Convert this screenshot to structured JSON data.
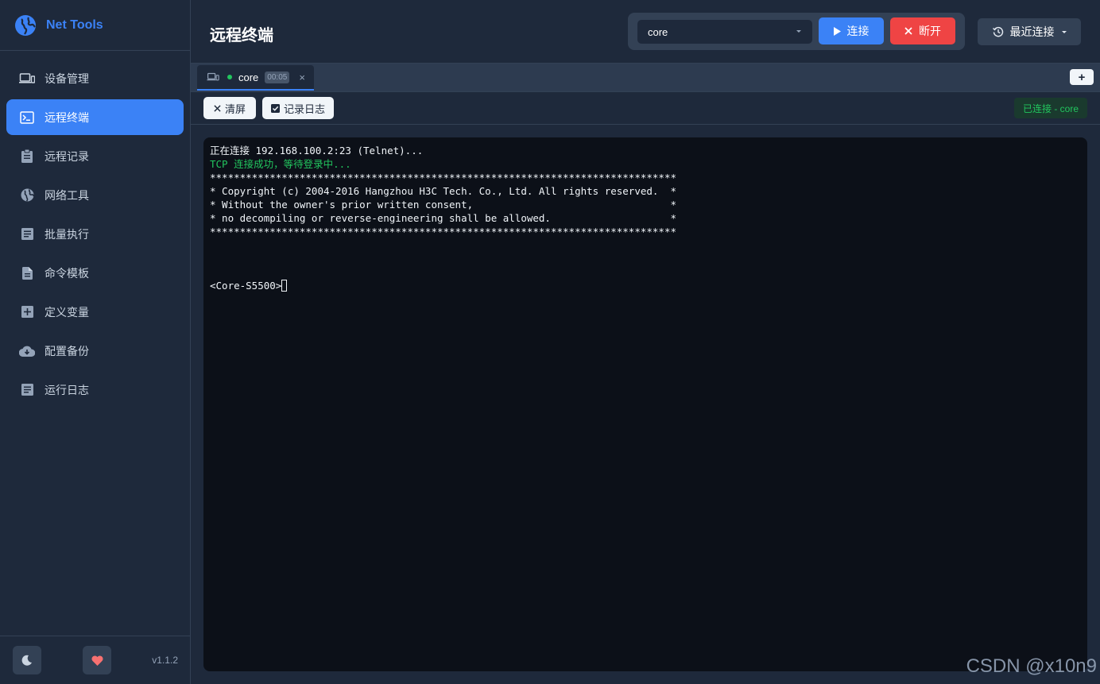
{
  "app": {
    "name": "Net Tools",
    "version": "v1.1.2"
  },
  "sidebar": {
    "items": [
      {
        "label": "设备管理",
        "icon": "devices-icon"
      },
      {
        "label": "远程终端",
        "icon": "terminal-icon",
        "active": true
      },
      {
        "label": "远程记录",
        "icon": "clipboard-icon"
      },
      {
        "label": "网络工具",
        "icon": "globe-icon"
      },
      {
        "label": "批量执行",
        "icon": "list-icon"
      },
      {
        "label": "命令模板",
        "icon": "file-icon"
      },
      {
        "label": "定义变量",
        "icon": "plus-box-icon"
      },
      {
        "label": "配置备份",
        "icon": "cloud-download-icon"
      },
      {
        "label": "运行日志",
        "icon": "log-icon"
      }
    ]
  },
  "header": {
    "title": "远程终端",
    "device_select": "core",
    "connect_label": "连接",
    "disconnect_label": "断开",
    "recent_label": "最近连接"
  },
  "tabs": [
    {
      "label": "core",
      "timer": "00:05",
      "close": "×"
    }
  ],
  "tab_add": "+",
  "toolbar": {
    "clear_label": "清屏",
    "log_label": "记录日志",
    "status": "已连接 - core"
  },
  "terminal": {
    "lines": [
      "正在连接 192.168.100.2:23 (Telnet)...",
      "TCP 连接成功，等待登录中...",
      "******************************************************************************",
      "* Copyright (c) 2004-2016 Hangzhou H3C Tech. Co., Ltd. All rights reserved.  *",
      "* Without the owner's prior written consent,                                 *",
      "* no decompiling or reverse-engineering shall be allowed.                    *",
      "******************************************************************************",
      "",
      "",
      "",
      "<Core-S5500>"
    ]
  },
  "watermark": "CSDN @x10n9",
  "colors": {
    "accent": "#3b82f6",
    "danger": "#ef4444",
    "success": "#22c55e"
  }
}
